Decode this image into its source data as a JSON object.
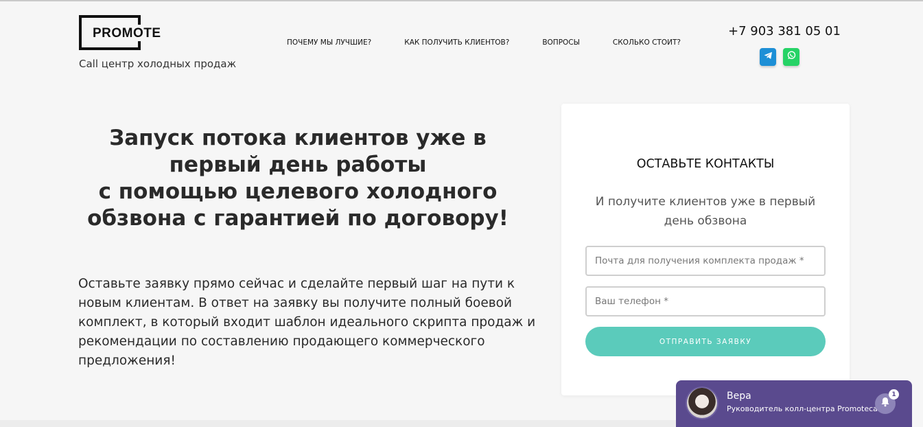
{
  "header": {
    "logo_text": "PROMOTE",
    "tagline": "Call центр холодных продаж",
    "nav": [
      {
        "label": "ПОЧЕМУ МЫ ЛУЧШИЕ?"
      },
      {
        "label": "КАК ПОЛУЧИТЬ КЛИЕНТОВ?"
      },
      {
        "label": "ВОПРОСЫ"
      },
      {
        "label": "СКОЛЬКО СТОИТ?"
      }
    ],
    "phone": "+7 903 381 05 01",
    "social": [
      {
        "icon": "telegram-icon",
        "color": "#1d8fd6"
      },
      {
        "icon": "whatsapp-icon",
        "color": "#26d366"
      }
    ]
  },
  "hero": {
    "title_lines": [
      "Запуск потока клиентов уже в",
      "первый день работы",
      "с помощью целевого холодного",
      "обзвона с гарантией по договору!"
    ],
    "text": "Оставьте заявку прямо сейчас и сделайте первый шаг на пути к новым клиентам. В ответ на заявку вы получите полный боевой комплект, в который входит шаблон идеального скрипта продаж и рекомендации по составлению продающего коммерческого предложения!"
  },
  "form": {
    "title": "ОСТАВЬТЕ КОНТАКТЫ",
    "subtitle": "И получите клиентов уже в первый день обзвона",
    "email_placeholder": "Почта для получения комплекта продаж *",
    "phone_placeholder": "Ваш телефон *",
    "email_value": "",
    "phone_value": "",
    "submit_label": "ОТПРАВИТЬ ЗАЯВКУ",
    "accent_color": "#5bcbbb"
  },
  "chat": {
    "name": "Вера",
    "role": "Руководитель колл-центра Promotecall",
    "badge_count": "1",
    "color": "#5a4a8e"
  }
}
